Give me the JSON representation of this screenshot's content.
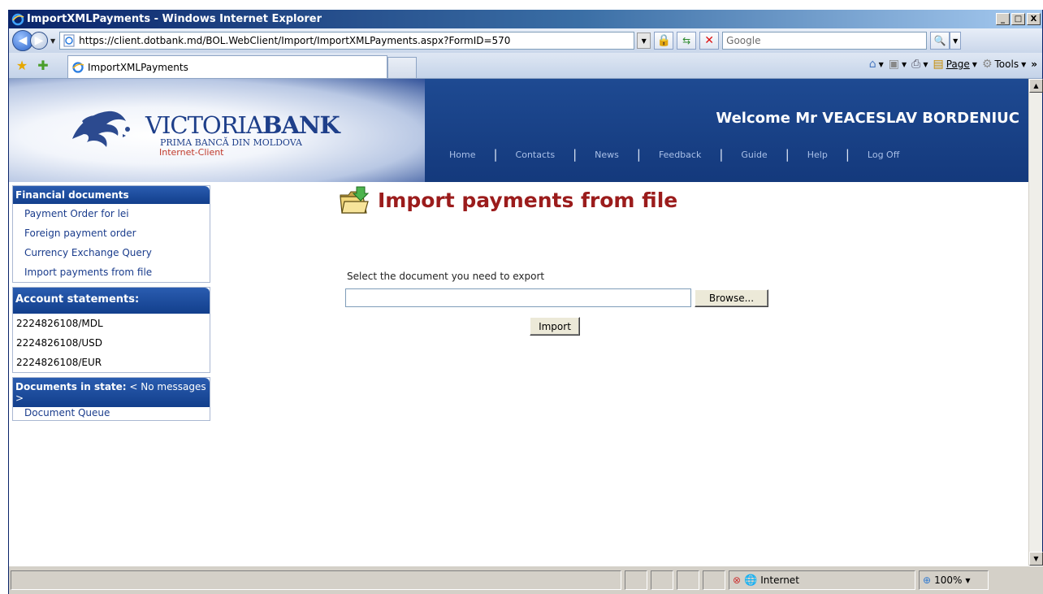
{
  "window": {
    "title": "ImportXMLPayments - Windows Internet Explorer",
    "minimize": "_",
    "maximize": "□",
    "close": "X"
  },
  "addressbar": {
    "url": "https://client.dotbank.md/BOL.WebClient/Import/ImportXMLPayments.aspx?FormID=570",
    "search_placeholder": "Google"
  },
  "tabs": {
    "active_tab": "ImportXMLPayments"
  },
  "commandbar": {
    "page_label": "Page",
    "tools_label": "Tools",
    "chevron": "»"
  },
  "site": {
    "logo_brand_a": "VICTORIA",
    "logo_brand_b": "BANK",
    "logo_tagline": "PRIMA BANCĂ DIN MOLDOVA",
    "logo_product": "Internet-Client",
    "welcome": "Welcome Mr VEACESLAV BORDENIUC",
    "nav": [
      "Home",
      "Contacts",
      "News",
      "Feedback",
      "Guide",
      "Help",
      "Log Off"
    ]
  },
  "sidebar": {
    "financial": {
      "title": "Financial documents",
      "items": [
        "Payment Order for lei",
        "Foreign payment order",
        "Currency Exchange Query",
        "Import payments from file"
      ]
    },
    "accounts": {
      "title": "Account statements:",
      "items": [
        "2224826108/MDL",
        "2224826108/USD",
        "2224826108/EUR"
      ]
    },
    "state": {
      "title": "Documents in state:",
      "title_value": " < No messages >",
      "items": [
        "Document Queue"
      ]
    }
  },
  "main": {
    "title": "Import payments from file",
    "select_label": "Select the document you need to export",
    "browse_label": "Browse...",
    "import_label": "Import"
  },
  "statusbar": {
    "zone": "Internet",
    "zoom": "100%"
  },
  "colors": {
    "title_red": "#9b1c1c",
    "header_blue": "#1e4a92",
    "link_blue": "#1a3c8c"
  }
}
